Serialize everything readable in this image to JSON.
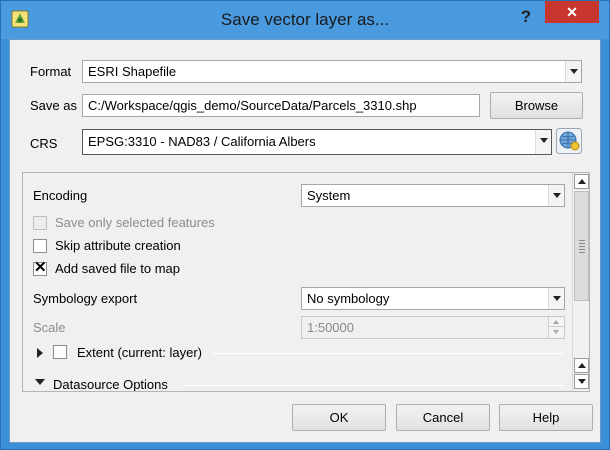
{
  "window": {
    "title": "Save vector layer as...",
    "app_icon": "qgis-icon",
    "help_label": "?",
    "close_label": "✕"
  },
  "format": {
    "label": "Format",
    "value": "ESRI Shapefile"
  },
  "save_as": {
    "label": "Save as",
    "value": "C:/Workspace/qgis_demo/SourceData/Parcels_3310.shp",
    "browse_label": "Browse"
  },
  "crs": {
    "label": "CRS",
    "value": "EPSG:3310 - NAD83 / California Albers",
    "selector_icon": "globe-crs-icon"
  },
  "options": {
    "encoding_label": "Encoding",
    "encoding_value": "System",
    "save_selected_label": "Save only selected features",
    "save_selected_checked": false,
    "save_selected_enabled": false,
    "skip_attr_label": "Skip attribute creation",
    "skip_attr_checked": false,
    "add_to_map_label": "Add saved file to map",
    "add_to_map_checked": true,
    "symbology_label": "Symbology export",
    "symbology_value": "No symbology",
    "scale_label": "Scale",
    "scale_value": "1:50000",
    "extent_label": "Extent (current: layer)",
    "extent_checked": false,
    "datasource_label": "Datasource Options"
  },
  "buttons": {
    "ok": "OK",
    "cancel": "Cancel",
    "help": "Help"
  },
  "colors": {
    "title_bar": "#4a9ae0",
    "close_button": "#c7372f",
    "dialog_bg": "#f0f0f0"
  }
}
